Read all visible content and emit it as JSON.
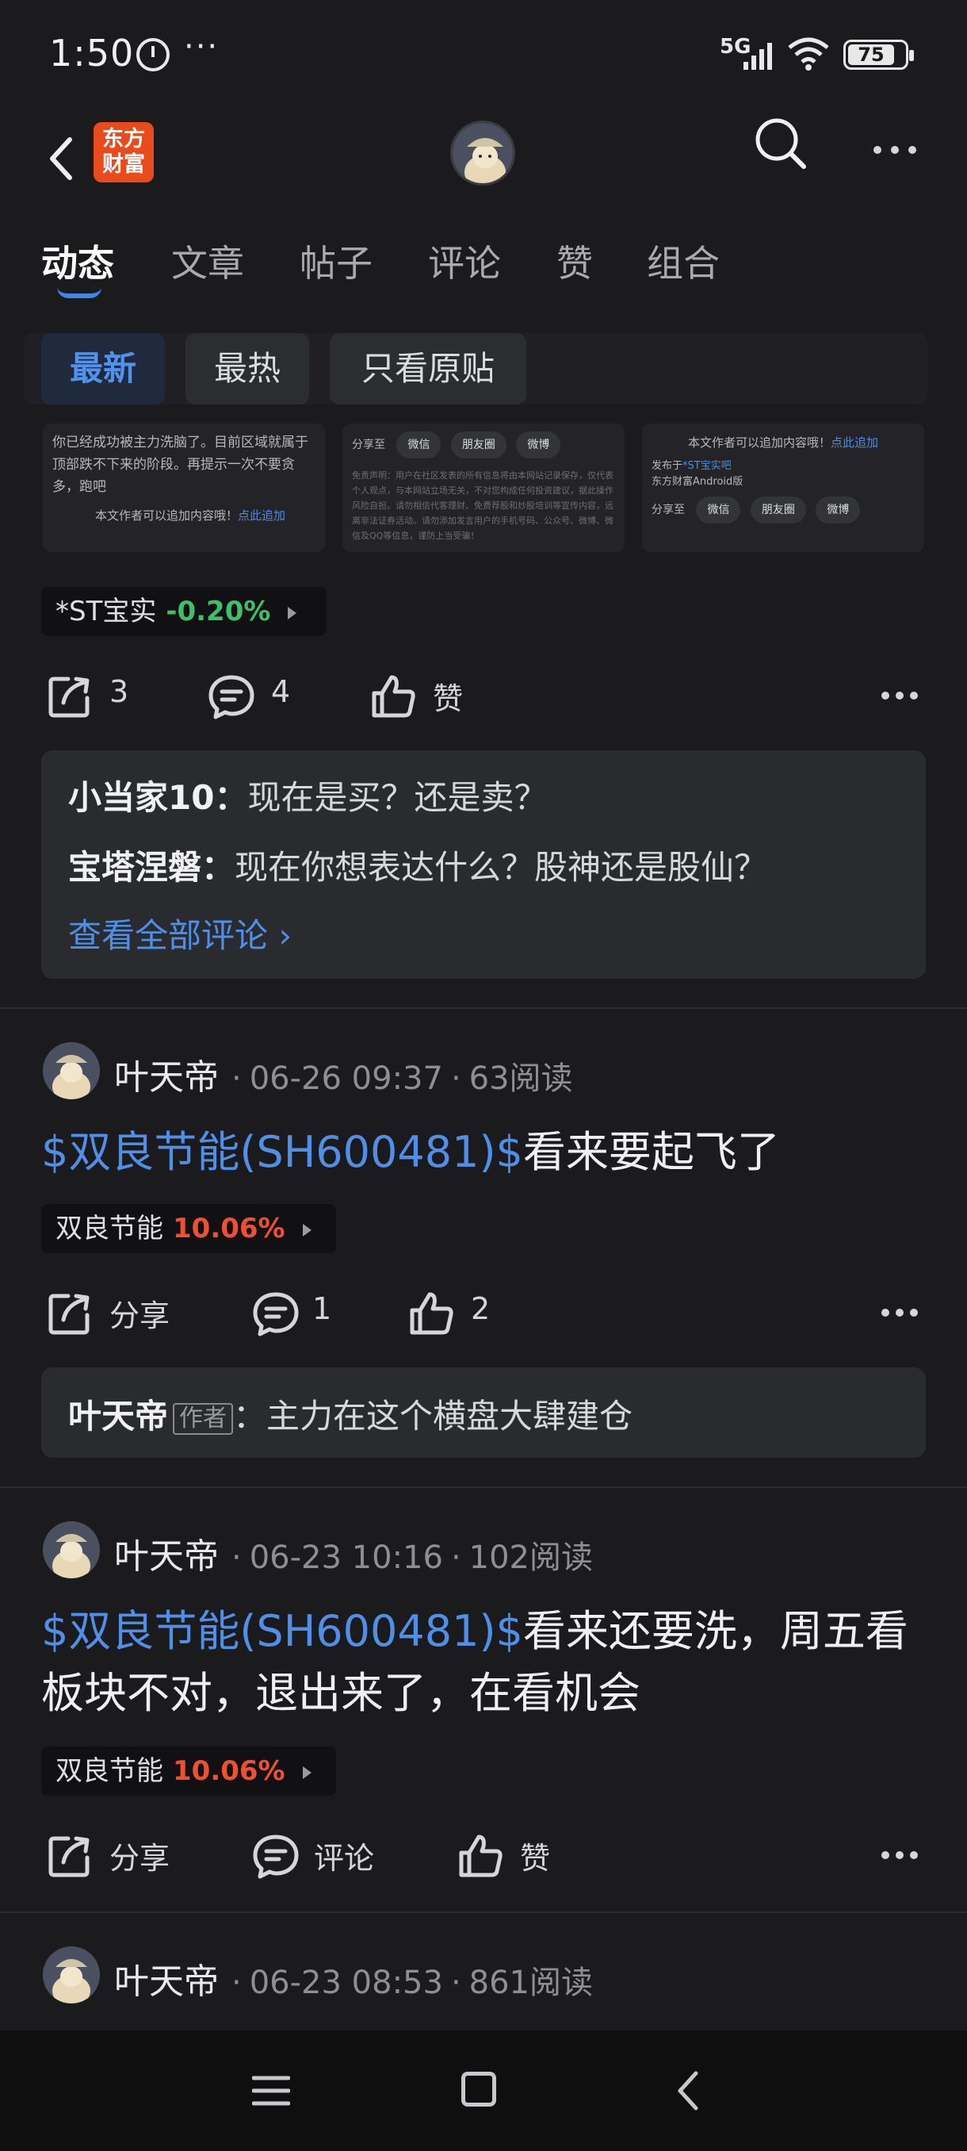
{
  "status_bar": {
    "time": "1:50",
    "more": "···",
    "network": "5G",
    "battery": "75"
  },
  "header": {
    "logo_text": "东方财富",
    "icons": [
      "back-arrow-icon",
      "avatar",
      "search-icon",
      "more-horizontal-icon"
    ]
  },
  "tabs": [
    "动态",
    "文章",
    "帖子",
    "评论",
    "赞",
    "组合"
  ],
  "active_tab": "动态",
  "filters": {
    "latest": "最新",
    "hot": "最热",
    "original": "只看原贴"
  },
  "thumbnails": {
    "t1_text": "你已经成功被主力洗脑了。目前区域就属于顶部跌不下来的阶段。再提示一次不要贪多，跑吧",
    "t1_footer": "本文作者可以追加内容哦！",
    "t1_link": "点此追加",
    "t2_share": "分享至",
    "t2_wechat": "微信",
    "t2_moments": "朋友圈",
    "t2_weibo": "微博",
    "t2_disclaimer": "免责声明：用户在社区发表的所有信息将由本网站记录保存，仅代表个人观点，与本网站立场无关，不对您构成任何投资建议，据此操作风险自担。请勿相信代客理财、免费荐股和炒股培训等宣传内容，远离非法证券活动。请勿添加发言用户的手机号码、公众号、微博、微信及QQ等信息，谨防上当受骗！",
    "t3_footer": "本文作者可以追加内容哦！",
    "t3_link": "点此追加",
    "t3_from_prefix": "发布于",
    "t3_from_tag": "*ST宝实吧",
    "t3_client": "东方财富Android版"
  },
  "post1": {
    "stock_name": "*ST宝实",
    "stock_change": "-0.20%",
    "share_count": "3",
    "comment_count": "4",
    "like_label": "赞",
    "comments": [
      {
        "author": "小当家10：",
        "text": "现在是买？还是卖？"
      },
      {
        "author": "宝塔涅磐：",
        "text": "现在你想表达什么？股神还是股仙？"
      }
    ],
    "view_all": "查看全部评论 ›"
  },
  "post2": {
    "username": "叶天帝",
    "date": "06-26 09:37",
    "reads": "63阅读",
    "link": "$双良节能(SH600481)$",
    "text": "看来要起飞了",
    "stock_name": "双良节能",
    "stock_change": "10.06%",
    "share_label": "分享",
    "comment_count": "1",
    "like_count": "2",
    "comment_author": "叶天帝",
    "author_tag": "作者",
    "comment_text": "：主力在这个横盘大肆建仓"
  },
  "post3": {
    "username": "叶天帝",
    "date": "06-23 10:16",
    "reads": "102阅读",
    "link": "$双良节能(SH600481)$",
    "text_line1": "看来还要洗，周五看",
    "text_line2": "板块不对，退出来了，在看机会",
    "stock_name": "双良节能",
    "stock_change": "10.06%",
    "share_label": "分享",
    "comment_label": "评论",
    "like_label": "赞"
  },
  "post4": {
    "username": "叶天帝",
    "date": "06-23 08:53",
    "reads": "861阅读"
  },
  "colors": {
    "background": "#1b1b1d",
    "accent_blue": "#4f8fe8",
    "stock_down_green": "#3fbf6a",
    "stock_up_red": "#f0502e",
    "logo_orange": "#e94b1c"
  }
}
